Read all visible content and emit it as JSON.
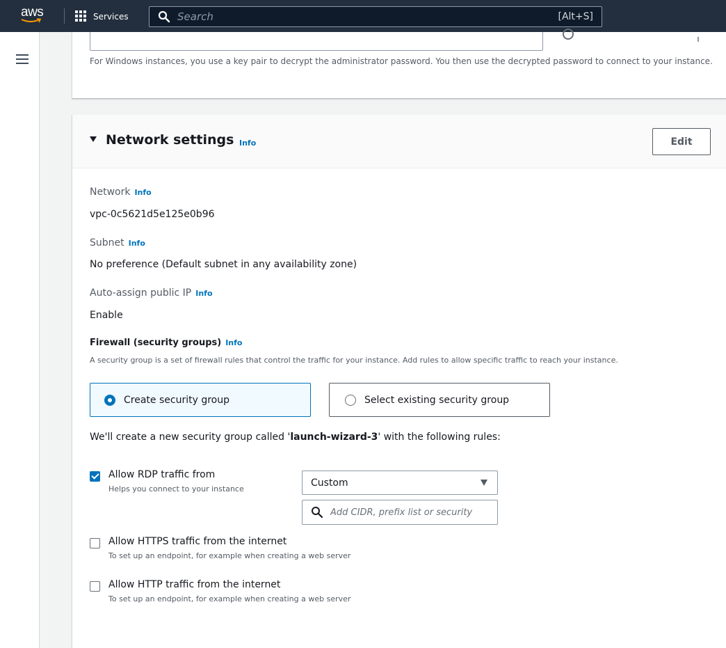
{
  "topnav": {
    "logo_text": "aws",
    "services_label": "Services",
    "search_placeholder": "Search",
    "search_shortcut": "[Alt+S]"
  },
  "keypair": {
    "windows_note": "For Windows instances, you use a key pair to decrypt the administrator password. You then use the decrypted password to connect to your instance."
  },
  "network": {
    "title": "Network settings",
    "info": "Info",
    "edit_label": "Edit",
    "fields": [
      {
        "label": "Network",
        "info": "Info",
        "value": "vpc-0c5621d5e125e0b96"
      },
      {
        "label": "Subnet",
        "info": "Info",
        "value": "No preference (Default subnet in any availability zone)"
      },
      {
        "label": "Auto-assign public IP",
        "info": "Info",
        "value": "Enable"
      }
    ],
    "firewall": {
      "title": "Firewall (security groups)",
      "info": "Info",
      "description": "A security group is a set of firewall rules that control the traffic for your instance. Add rules to allow specific traffic to reach your instance.",
      "options": [
        {
          "label": "Create security group",
          "selected": true
        },
        {
          "label": "Select existing security group",
          "selected": false
        }
      ],
      "sentence_prefix": "We'll create a new security group called '",
      "sentence_name": "launch-wizard-3",
      "sentence_suffix": "' with the following rules:"
    },
    "rules": [
      {
        "label": "Allow RDP traffic from",
        "description": "Helps you connect to your instance",
        "checked": true
      },
      {
        "label": "Allow HTTPS traffic from the internet",
        "description": "To set up an endpoint, for example when creating a web server",
        "checked": false
      },
      {
        "label": "Allow HTTP traffic from the internet",
        "description": "To set up an endpoint, for example when creating a web server",
        "checked": false
      }
    ],
    "rdp_source": {
      "selected": "Custom",
      "cidr_placeholder": "Add CIDR, prefix list or security"
    }
  },
  "colors": {
    "nav_bg": "#232f3e",
    "accent": "#0073bb",
    "aws_orange": "#ff9900"
  }
}
